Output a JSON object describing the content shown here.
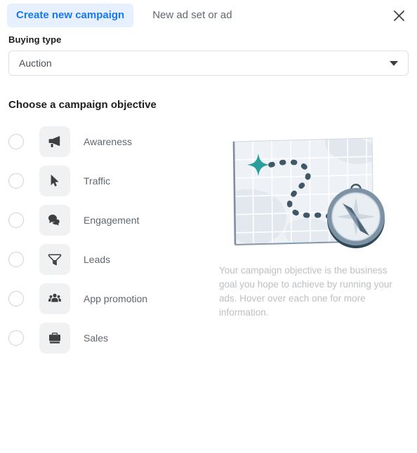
{
  "tabs": [
    {
      "label": "Create new campaign",
      "active": true
    },
    {
      "label": "New ad set or ad",
      "active": false
    }
  ],
  "close_icon": "close-icon",
  "buying_type": {
    "label": "Buying type",
    "value": "Auction",
    "caret_icon": "chevron-down-icon"
  },
  "objective_section": {
    "title": "Choose a campaign objective",
    "items": [
      {
        "label": "Awareness",
        "icon": "megaphone-icon",
        "selected": false
      },
      {
        "label": "Traffic",
        "icon": "cursor-arrow-icon",
        "selected": false
      },
      {
        "label": "Engagement",
        "icon": "speech-bubbles-icon",
        "selected": false
      },
      {
        "label": "Leads",
        "icon": "funnel-icon",
        "selected": false
      },
      {
        "label": "App promotion",
        "icon": "people-group-icon",
        "selected": false
      },
      {
        "label": "Sales",
        "icon": "briefcase-icon",
        "selected": false
      }
    ]
  },
  "info_panel": {
    "illustration": "map-with-compass-illustration",
    "description": "Your campaign objective is the business goal you hope to achieve by running your ads. Hover over each one for more information."
  },
  "colors": {
    "accent_blue": "#1877f2",
    "accent_blue_bg": "#e7f0fe",
    "text_primary": "#1c1e21",
    "text_secondary": "#606770",
    "text_muted": "#bcc0c4",
    "tile_bg": "#f0f1f2",
    "border": "#dddfe2",
    "illustration_teal": "#2a9d9d",
    "illustration_dark": "#3b5563"
  }
}
